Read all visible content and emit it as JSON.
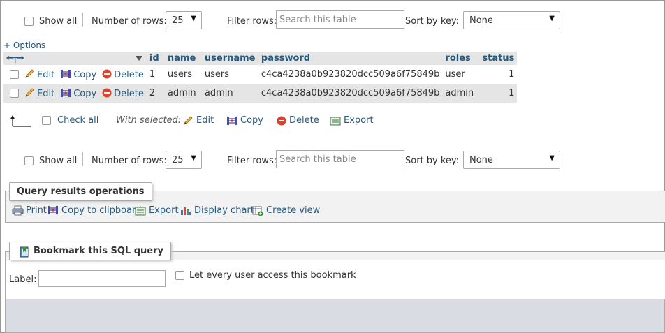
{
  "top_toolbar": {
    "show_all": "Show all",
    "number_of_rows_label": "Number of rows:",
    "rows_value": "25",
    "filter_label": "Filter rows:",
    "filter_placeholder": "Search this table",
    "sort_label": "Sort by key:",
    "sort_value": "None"
  },
  "options_link": "+ Options",
  "table": {
    "columns": [
      "id",
      "name",
      "username",
      "password",
      "roles",
      "status"
    ],
    "actions": {
      "edit": "Edit",
      "copy": "Copy",
      "delete": "Delete"
    },
    "rows": [
      {
        "id": "1",
        "name": "users",
        "username": "users",
        "password": "c4ca4238a0b923820dcc509a6f75849b",
        "roles": "user",
        "status": "1"
      },
      {
        "id": "2",
        "name": "admin",
        "username": "admin",
        "password": "c4ca4238a0b923820dcc509a6f75849b",
        "roles": "admin",
        "status": "1"
      }
    ]
  },
  "with_selected": {
    "check_all": "Check all",
    "label": "With selected:",
    "edit": "Edit",
    "copy": "Copy",
    "delete": "Delete",
    "export": "Export"
  },
  "bottom_toolbar": {
    "show_all": "Show all",
    "number_of_rows_label": "Number of rows:",
    "rows_value": "25",
    "filter_label": "Filter rows:",
    "filter_placeholder": "Search this table",
    "sort_label": "Sort by key:",
    "sort_value": "None"
  },
  "query_ops": {
    "title": "Query results operations",
    "print": "Print",
    "copy_clipboard": "Copy to clipboard",
    "export": "Export",
    "display_chart": "Display chart",
    "create_view": "Create view"
  },
  "bookmark": {
    "title": "Bookmark this SQL query",
    "label": "Label:",
    "label_value": "",
    "public_checkbox": "Let every user access this bookmark"
  },
  "colors": {
    "link": "#235a81",
    "row_alt": "#e5e5e5",
    "panel": "#f2f2f2"
  }
}
